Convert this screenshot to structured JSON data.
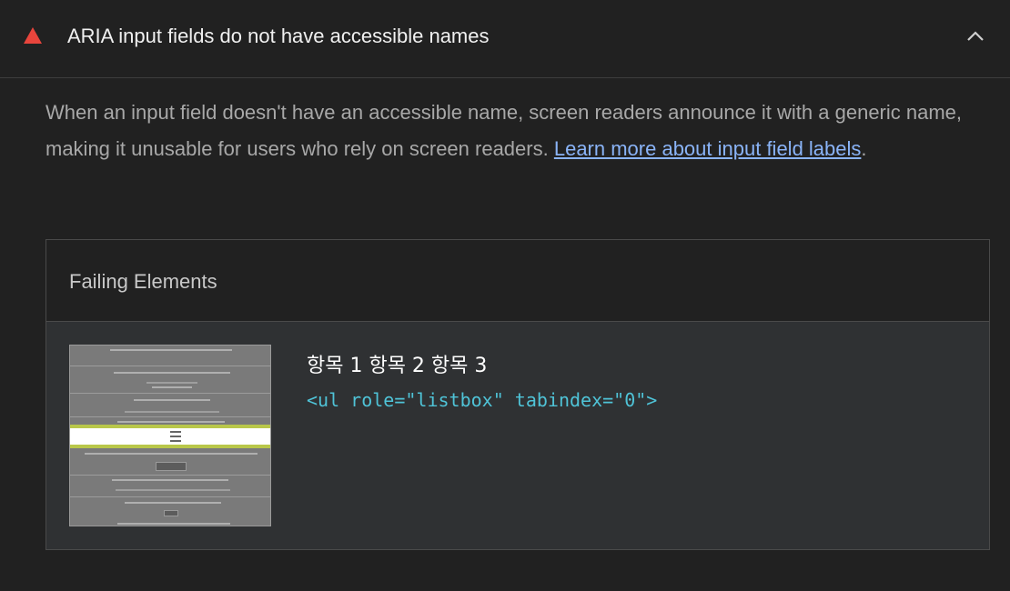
{
  "audit": {
    "title": "ARIA input fields do not have accessible names",
    "status": "fail",
    "icons": {
      "status": "warning-triangle-icon",
      "toggle": "chevron-up-icon"
    },
    "colors": {
      "fail": "#e8453c",
      "link": "#8ab4f8",
      "code": "#4fc3d7"
    }
  },
  "description": {
    "text": "When an input field doesn't have an accessible name, screen readers announce it with a generic name, making it unusable for users who rely on screen readers. ",
    "link_text": "Learn more about input field labels",
    "suffix": "."
  },
  "table": {
    "header": "Failing Elements",
    "rows": [
      {
        "node_label": "항목 1 항목 2 항목 3",
        "snippet": "<ul role=\"listbox\" tabindex=\"0\">"
      }
    ]
  }
}
